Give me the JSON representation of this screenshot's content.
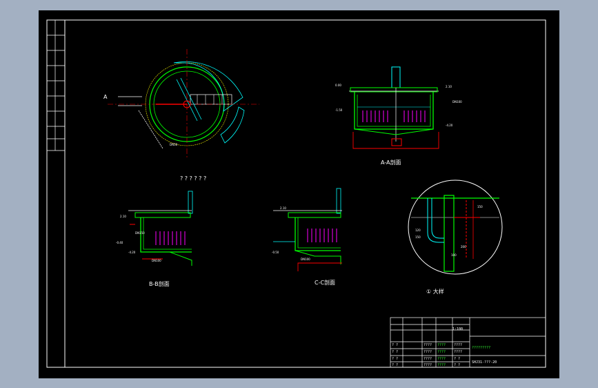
{
  "views": {
    "plan_title": "? ? ? ? ? ?",
    "aa_title": "A-A剖面",
    "bb_title": "B-B剖面",
    "cc_title": "C-C剖面",
    "detail_title": "① 大样"
  },
  "plan": {
    "marker_a": "A",
    "dim_dn": "DN50"
  },
  "section_aa": {
    "elev_top": "2.10",
    "elev_mid": "0.00",
    "elev_low": "-1.50",
    "elev_bottom": "-4.20",
    "note": "DN100"
  },
  "section_bb": {
    "elev_top": "2.10",
    "elev_low": "-0.40",
    "elev_bottom": "-4.20",
    "pipe": "DN100",
    "pipe2": "DN150"
  },
  "section_cc": {
    "elev_top": "2.10",
    "elev_low": "-0.50",
    "pipe": "DN100"
  },
  "detail": {
    "label_a": "120",
    "label_b": "150",
    "label_c": "150",
    "label_d": "200",
    "label_e": "100"
  },
  "title_block": {
    "rows": [
      [
        "? ?",
        "????",
        "????",
        "????"
      ],
      [
        "? ?",
        "????",
        "????",
        "????"
      ],
      [
        "? ?",
        "????",
        "????",
        "? ?"
      ],
      [
        "? ?",
        "????",
        "????",
        "? ?"
      ]
    ],
    "company": "?????????",
    "drawing_no": "SHJ31-???-20",
    "sheet": "1:100"
  },
  "colors": {
    "frame": "#ffffff",
    "structure": "#00ff00",
    "water": "#00ffff",
    "pipe": "#ff0000",
    "fill": "#ff00ff",
    "rim": "#ffff00"
  }
}
